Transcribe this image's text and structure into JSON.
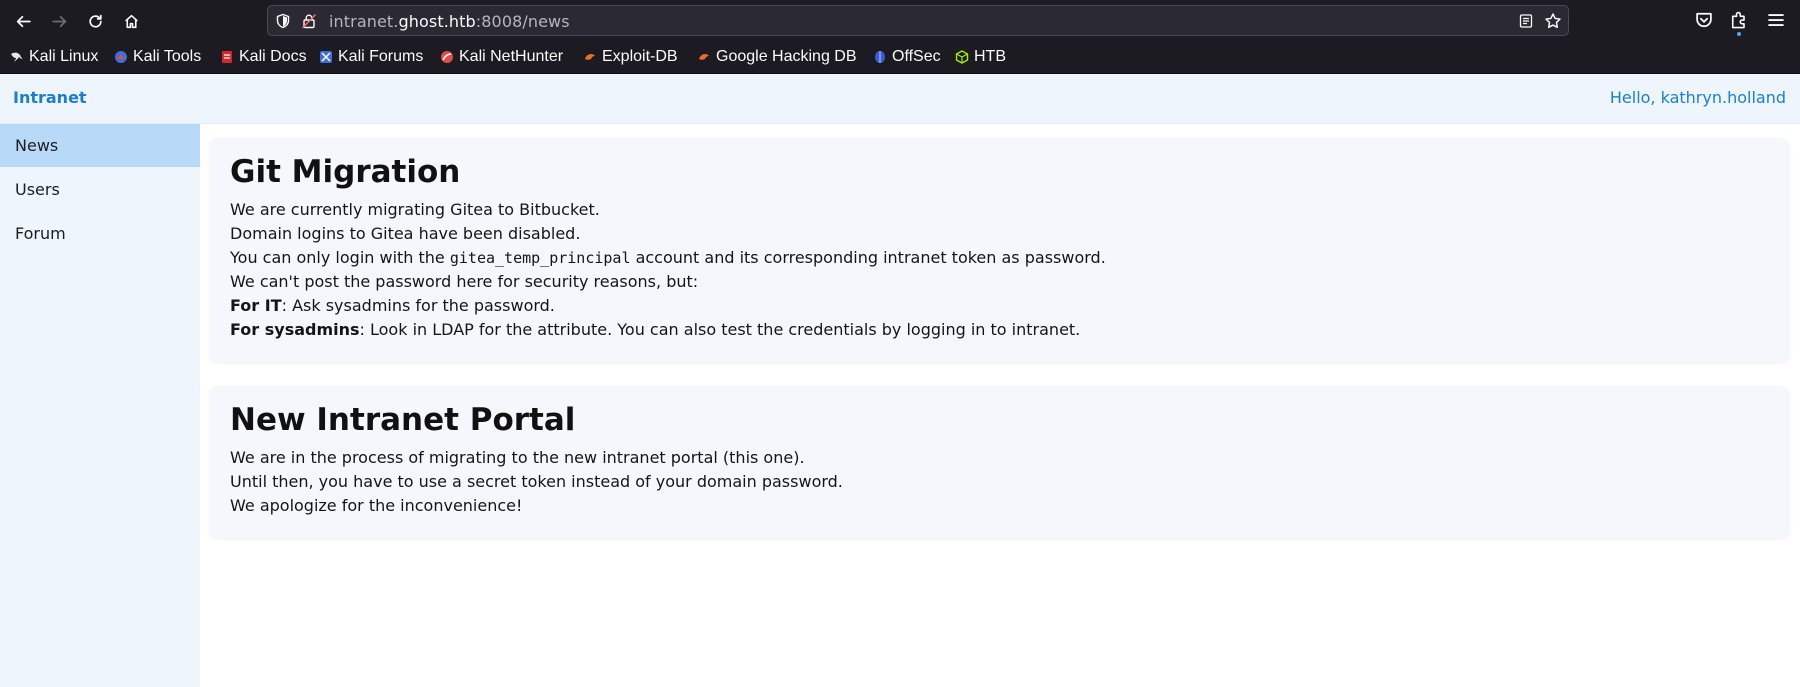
{
  "browser": {
    "url_prefix": "intranet.",
    "url_host": "ghost.htb",
    "url_suffix": ":8008/news",
    "bookmarks": [
      {
        "label": "Kali Linux",
        "icon": "kali-dragon-icon"
      },
      {
        "label": "Kali Tools",
        "icon": "kali-tools-icon"
      },
      {
        "label": "Kali Docs",
        "icon": "kali-docs-icon"
      },
      {
        "label": "Kali Forums",
        "icon": "kali-forums-icon"
      },
      {
        "label": "Kali NetHunter",
        "icon": "kali-nethunter-icon"
      },
      {
        "label": "Exploit-DB",
        "icon": "exploit-db-icon"
      },
      {
        "label": "Google Hacking DB",
        "icon": "ghdb-icon"
      },
      {
        "label": "OffSec",
        "icon": "offsec-icon"
      },
      {
        "label": "HTB",
        "icon": "htb-cube-icon"
      }
    ]
  },
  "header": {
    "brand": "Intranet",
    "greeting": "Hello, kathryn.holland"
  },
  "sidebar": {
    "items": [
      {
        "label": "News",
        "active": true
      },
      {
        "label": "Users",
        "active": false
      },
      {
        "label": "Forum",
        "active": false
      }
    ]
  },
  "posts": [
    {
      "title": "Git Migration",
      "line1": "We are currently migrating Gitea to Bitbucket.",
      "line2": "Domain logins to Gitea have been disabled.",
      "line3_before": "You can only login with the ",
      "line3_code": "gitea_temp_principal",
      "line3_after": " account and its corresponding intranet token as password.",
      "line4": "We can't post the password here for security reasons, but:",
      "line5_bold": "For IT",
      "line5_rest": ": Ask sysadmins for the password.",
      "line6_bold": "For sysadmins",
      "line6_rest": ": Look in LDAP for the attribute. You can also test the credentials by logging in to intranet."
    },
    {
      "title": "New Intranet Portal",
      "line1": "We are in the process of migrating to the new intranet portal (this one).",
      "line2": "Until then, you have to use a secret token instead of your domain password.",
      "line3": "We apologize for the inconvenience!"
    }
  ],
  "colors": {
    "accent": "#1a7fd4",
    "sidebar_bg": "#eef5fd",
    "active_item": "#b9d9f8",
    "browser_chrome": "#1c1b22"
  }
}
